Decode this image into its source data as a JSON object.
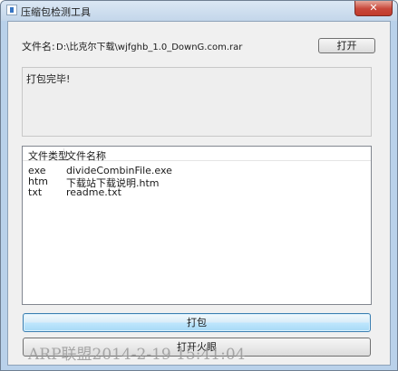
{
  "window": {
    "title": "压缩包检测工具",
    "close_label": "✕"
  },
  "form": {
    "file_label": "文件名:",
    "file_path": "D:\\比克尔下载\\wjfghb_1.0_DownG.com.rar",
    "open_label": "打开"
  },
  "status": {
    "text": "打包完毕!"
  },
  "file_list": {
    "columns": [
      "文件类型",
      "文件名称"
    ],
    "rows": [
      {
        "type": "exe",
        "name": "divideCombinFile.exe"
      },
      {
        "type": "htm",
        "name": "下载站下载说明.htm"
      },
      {
        "type": "txt",
        "name": "readme.txt"
      }
    ]
  },
  "actions": {
    "pack_label": "打包",
    "fire_label": "打开火眼"
  },
  "watermark": {
    "text": "ARP联盟2014-2-19 15:41:04"
  },
  "colors": {
    "window_frame": "#b9d1ea",
    "client_bg": "#f0f0f0",
    "close_button": "#c8473a",
    "focused_button": "#bee6fd"
  }
}
